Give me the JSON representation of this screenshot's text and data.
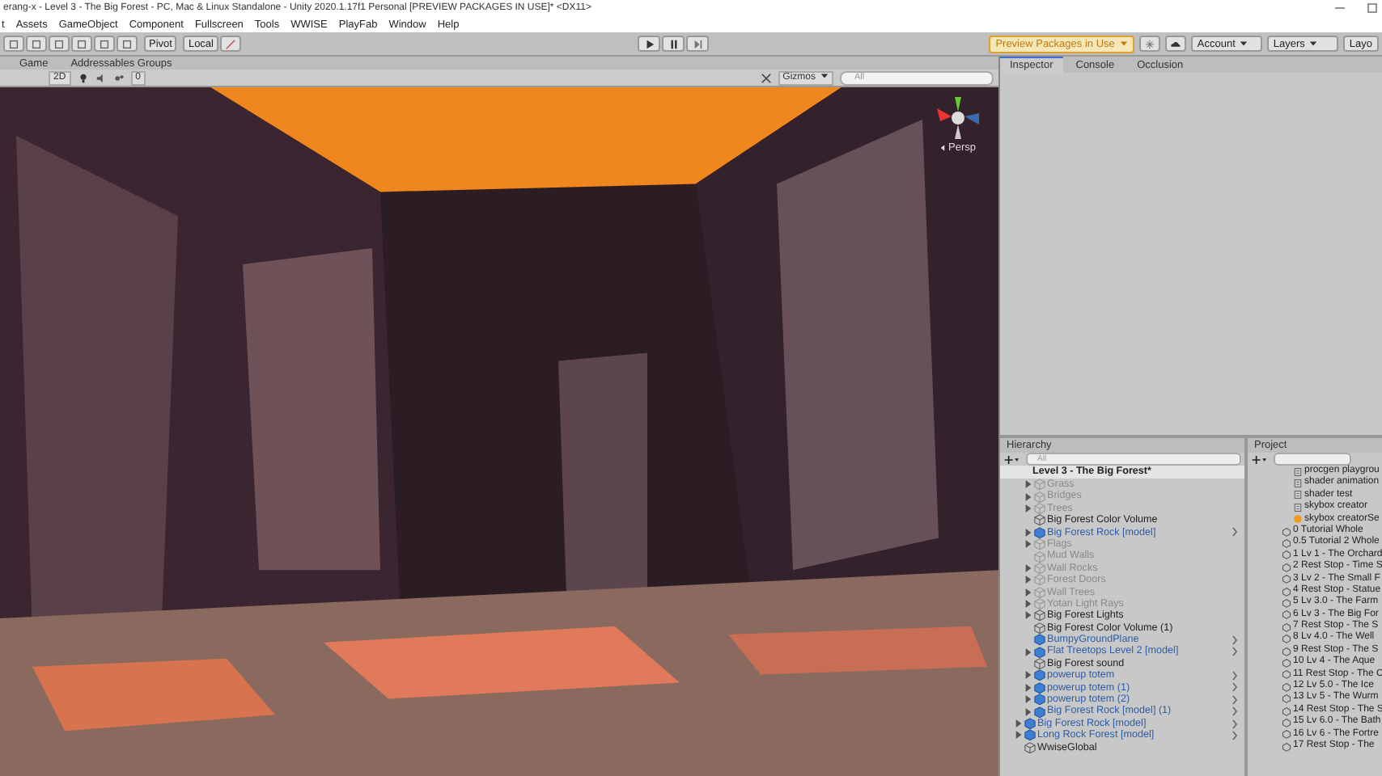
{
  "window": {
    "title": "erang-x - Level 3 - The Big Forest - PC, Mac & Linux Standalone - Unity 2020.1.17f1 Personal [PREVIEW PACKAGES IN USE]* <DX11>"
  },
  "menu": [
    "t",
    "Assets",
    "GameObject",
    "Component",
    "Fullscreen",
    "Tools",
    "WWISE",
    "PlayFab",
    "Window",
    "Help"
  ],
  "toolbar": {
    "pivot": "Pivot",
    "local": "Local",
    "preview": "Preview Packages in Use",
    "account": "Account",
    "layers": "Layers",
    "layout": "Layo"
  },
  "scene_tabs": [
    {
      "label": "Game"
    },
    {
      "label": "Addressables Groups"
    }
  ],
  "scene_toolbar": {
    "mode": "2D",
    "hidden_count": "0",
    "gizmos": "Gizmos",
    "search_placeholder": "All"
  },
  "scene_view": {
    "projection": "Persp"
  },
  "inspector_tabs": [
    {
      "label": "Inspector",
      "selected": true
    },
    {
      "label": "Console",
      "selected": false
    },
    {
      "label": "Occlusion",
      "selected": false
    }
  ],
  "hierarchy": {
    "title": "Hierarchy",
    "search_placeholder": "All",
    "scene": {
      "name": "Level 3 - The Big Forest*",
      "children": [
        {
          "name": "Grass",
          "kind": "object",
          "active": false,
          "expandable": true
        },
        {
          "name": "Bridges",
          "kind": "object",
          "active": false,
          "expandable": true
        },
        {
          "name": "Trees",
          "kind": "object",
          "active": false,
          "expandable": true
        },
        {
          "name": "Big Forest Color Volume",
          "kind": "object",
          "active": true,
          "expandable": false
        },
        {
          "name": "Big Forest Rock [model]",
          "kind": "prefab",
          "active": true,
          "expandable": true
        },
        {
          "name": "Flags",
          "kind": "object",
          "active": false,
          "expandable": true
        },
        {
          "name": "Mud Walls",
          "kind": "object",
          "active": false,
          "expandable": false
        },
        {
          "name": "Wall Rocks",
          "kind": "object",
          "active": false,
          "expandable": true
        },
        {
          "name": "Forest Doors",
          "kind": "object",
          "active": false,
          "expandable": true
        },
        {
          "name": "Wall Trees",
          "kind": "object",
          "active": false,
          "expandable": true
        },
        {
          "name": "Yotan Light Rays",
          "kind": "object",
          "active": false,
          "expandable": true
        },
        {
          "name": "Big Forest Lights",
          "kind": "object",
          "active": true,
          "expandable": true
        },
        {
          "name": "Big Forest Color Volume (1)",
          "kind": "object",
          "active": true,
          "expandable": false
        },
        {
          "name": "BumpyGroundPlane",
          "kind": "prefab",
          "active": true,
          "expandable": false
        },
        {
          "name": "Flat Treetops Level 2 [model]",
          "kind": "prefab",
          "active": true,
          "expandable": true
        },
        {
          "name": "Big Forest sound",
          "kind": "object",
          "active": true,
          "expandable": false
        },
        {
          "name": "powerup totem",
          "kind": "prefab",
          "active": true,
          "expandable": true
        },
        {
          "name": "powerup totem (1)",
          "kind": "prefab",
          "active": true,
          "expandable": true
        },
        {
          "name": "powerup totem (2)",
          "kind": "prefab",
          "active": true,
          "expandable": true
        },
        {
          "name": "Big Forest Rock [model] (1)",
          "kind": "prefab",
          "active": true,
          "expandable": true
        }
      ]
    },
    "outer_items": [
      {
        "name": "Big Forest Rock [model]",
        "kind": "prefab",
        "active": true,
        "expandable": true
      },
      {
        "name": "Long Rock Forest [model]",
        "kind": "prefab",
        "active": true,
        "expandable": true
      },
      {
        "name": "WwiseGlobal",
        "kind": "object",
        "active": true,
        "expandable": false
      }
    ]
  },
  "project": {
    "title": "Project",
    "items": [
      {
        "name": "procgen playgrou",
        "kind": "shader"
      },
      {
        "name": "shader animation",
        "kind": "shader"
      },
      {
        "name": "shader test",
        "kind": "shader"
      },
      {
        "name": "skybox creator",
        "kind": "shader"
      },
      {
        "name": "skybox creatorSe",
        "kind": "material"
      },
      {
        "name": "0 Tutorial Whole",
        "kind": "scene"
      },
      {
        "name": "0.5 Tutorial 2 Whole",
        "kind": "scene"
      },
      {
        "name": "1 Lv 1 - The Orchard",
        "kind": "scene"
      },
      {
        "name": "2 Rest Stop - Time S",
        "kind": "scene"
      },
      {
        "name": "3 Lv 2 - The Small F",
        "kind": "scene"
      },
      {
        "name": "4 Rest Stop - Statue",
        "kind": "scene"
      },
      {
        "name": "5 Lv 3.0 - The Farm",
        "kind": "scene"
      },
      {
        "name": "6 Lv 3 - The Big For",
        "kind": "scene"
      },
      {
        "name": "7 Rest Stop - The S",
        "kind": "scene"
      },
      {
        "name": "8 Lv 4.0 - The Well",
        "kind": "scene"
      },
      {
        "name": "9 Rest Stop - The S",
        "kind": "scene"
      },
      {
        "name": "10 Lv 4 - The Aque",
        "kind": "scene"
      },
      {
        "name": "11 Rest Stop - The C",
        "kind": "scene"
      },
      {
        "name": "12 Lv 5.0 - The Ice",
        "kind": "scene"
      },
      {
        "name": "13 Lv 5 - The Wurm",
        "kind": "scene"
      },
      {
        "name": "14 Rest Stop - The S",
        "kind": "scene"
      },
      {
        "name": "15 Lv 6.0 - The Bath",
        "kind": "scene"
      },
      {
        "name": "16 Lv 6 - The Fortre",
        "kind": "scene"
      },
      {
        "name": "17 Rest Stop - The",
        "kind": "scene"
      }
    ]
  }
}
